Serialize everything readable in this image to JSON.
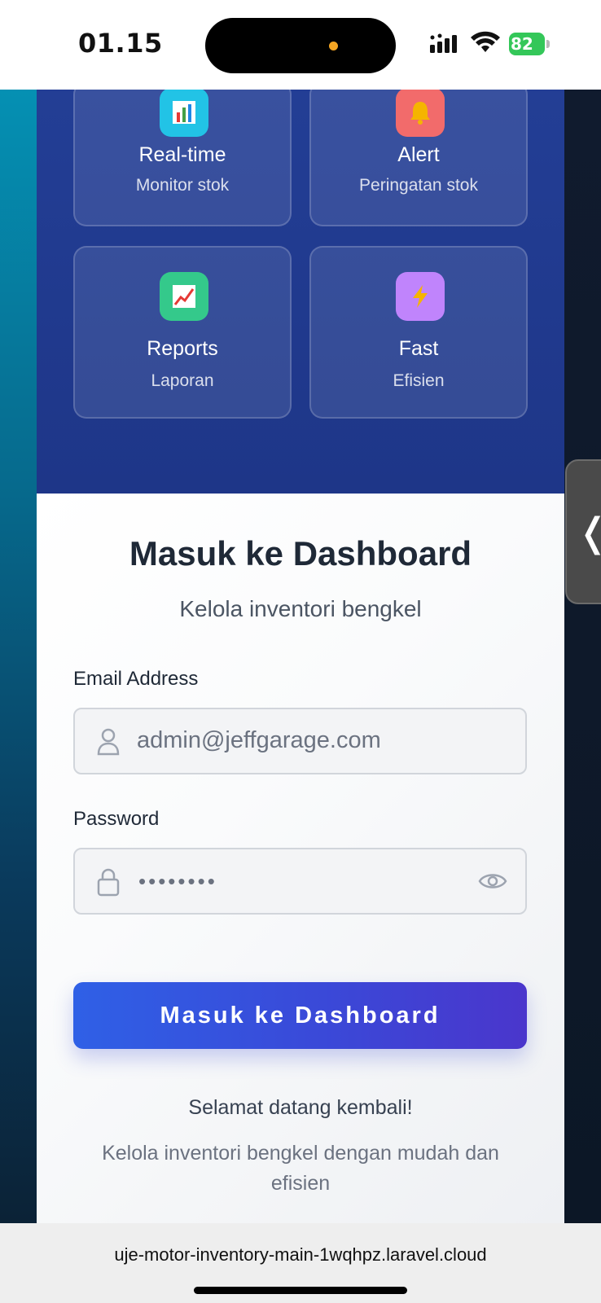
{
  "status_bar": {
    "time": "01.15",
    "battery": "82"
  },
  "features": [
    {
      "title": "Real-time",
      "subtitle": "Monitor stok",
      "icon": "bar-chart-icon",
      "color": "#22c3e6"
    },
    {
      "title": "Alert",
      "subtitle": "Peringatan stok",
      "icon": "bell-icon",
      "color": "#f26b6b"
    },
    {
      "title": "Reports",
      "subtitle": "Laporan",
      "icon": "trend-chart-icon",
      "color": "#34c98b"
    },
    {
      "title": "Fast",
      "subtitle": "Efisien",
      "icon": "lightning-icon",
      "color": "#c084fc"
    }
  ],
  "login": {
    "title": "Masuk ke Dashboard",
    "subtitle": "Kelola inventori bengkel",
    "email_label": "Email Address",
    "email_value": "admin@jeffgarage.com",
    "password_label": "Password",
    "password_value": "••••••••",
    "submit_label": "Masuk ke Dashboard",
    "welcome": "Selamat datang kembali!",
    "welcome_desc": "Kelola inventori bengkel dengan mudah dan efisien"
  },
  "browser": {
    "url": "uje-motor-inventory-main-1wqhpz.laravel.cloud"
  },
  "colors": {
    "primary_blue": "#233e95",
    "button_gradient_start": "#2f60e6",
    "button_gradient_end": "#4a36cc"
  }
}
